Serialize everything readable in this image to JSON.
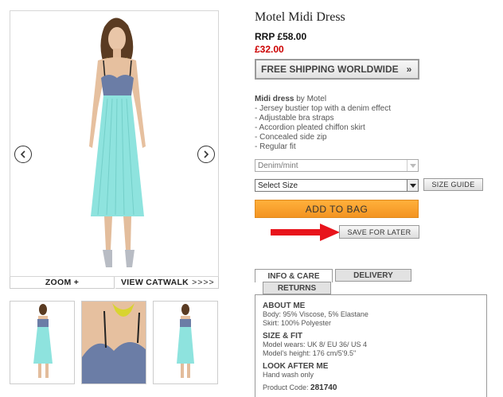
{
  "product": {
    "title": "Motel Midi Dress",
    "rrp": "RRP £58.00",
    "price": "£32.00",
    "shipping_banner": "FREE SHIPPING WORLDWIDE",
    "shipping_arrow": "»"
  },
  "description": {
    "name": "Midi dress",
    "by": " by Motel",
    "bullets": [
      "- Jersey bustier top with a denim effect",
      "- Adjustable bra straps",
      "- Accordion pleated chiffon skirt",
      "- Concealed side zip",
      "- Regular fit"
    ]
  },
  "selects": {
    "colour_value": "Denim/mint",
    "size_value": "Select Size"
  },
  "buttons": {
    "size_guide": "SIZE GUIDE",
    "add_to_bag": "ADD TO BAG",
    "save_for_later": "SAVE FOR LATER"
  },
  "gallery": {
    "zoom_label": "ZOOM +",
    "catwalk_label": "VIEW CATWALK",
    "catwalk_arrows": ">>>>"
  },
  "tabs": {
    "info": "INFO & CARE",
    "delivery": "DELIVERY",
    "returns": "RETURNS"
  },
  "info_panel": {
    "about_head": "ABOUT ME",
    "about_lines": [
      "Body: 95% Viscose, 5% Elastane",
      "Skirt: 100% Polyester"
    ],
    "size_head": "SIZE & FIT",
    "size_lines": [
      "Model wears: UK 8/ EU 36/ US 4",
      "Model's height: 176 cm/5'9.5\""
    ],
    "care_head": "LOOK AFTER ME",
    "care_lines": [
      "Hand wash only"
    ],
    "code_label": "Product Code: ",
    "code_value": "281740"
  },
  "colors": {
    "sale_red": "#cc0000",
    "add_bag_orange": "#f7a030",
    "arrow_red": "#e8141c",
    "denim": "#6b7da6",
    "mint": "#8ee3de"
  }
}
